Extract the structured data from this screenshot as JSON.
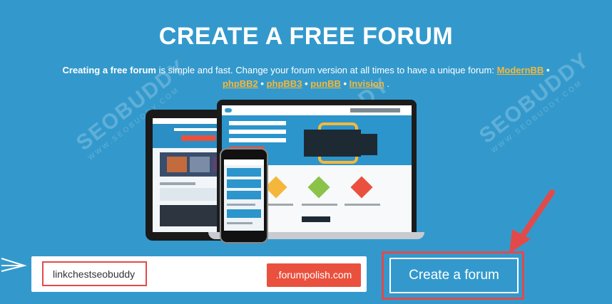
{
  "hero": {
    "title": "CREATE A FREE FORUM",
    "description_bold": "Creating a free forum",
    "description_text": " is simple and fast. Change your forum version at all times to have a unique forum: ",
    "versions": [
      "ModernBB",
      "phpBB2",
      "phpBB3",
      "punBB",
      "Invision"
    ],
    "separator": "•",
    "end": "."
  },
  "watermark": {
    "brand": "SEOBUDDY",
    "url": "WWW.SEOBUDDY.COM"
  },
  "form": {
    "subdomain_value": "linkchestseobuddy",
    "domain_suffix": ".forumpolish.com",
    "submit_label": "Create a forum"
  },
  "colors": {
    "background": "#3399cc",
    "link": "#f5b73b",
    "suffix_bg": "#e9513e",
    "highlight": "#e24a4a"
  }
}
